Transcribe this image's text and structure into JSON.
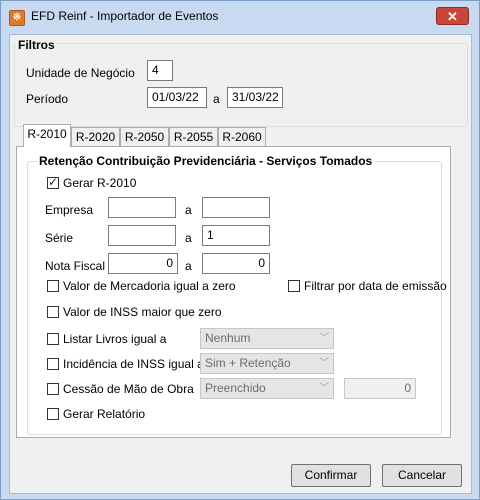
{
  "window": {
    "title": "EFD Reinf - Importador de Eventos",
    "close_glyph": "✕"
  },
  "filtros": {
    "title": "Filtros",
    "unidade_label": "Unidade de Negócio",
    "unidade_value": "4",
    "periodo_label": "Período",
    "periodo_from": "01/03/22",
    "periodo_sep": "a",
    "periodo_to": "31/03/22"
  },
  "tabs": [
    "R-2010",
    "R-2020",
    "R-2050",
    "R-2055",
    "R-2060"
  ],
  "r2010": {
    "group_title": "Retenção Contribuição Previdenciária - Serviços Tomados",
    "gerar_label": "Gerar R-2010",
    "gerar_checked": true,
    "empresa_label": "Empresa",
    "empresa_from": "",
    "empresa_to": "",
    "serie_label": "Série",
    "serie_from": "",
    "serie_to": "1",
    "nota_label": "Nota Fiscal",
    "nota_from": "0",
    "nota_to": "0",
    "sep": "a",
    "valor_mercadoria_label": "Valor de Mercadoria igual a zero",
    "filtrar_data_label": "Filtrar por data de emissão",
    "valor_inss_label": "Valor de INSS maior que zero",
    "listar_livros_label": "Listar Livros igual a",
    "listar_livros_value": "Nenhum",
    "incidencia_label": "Incidência de INSS igual a",
    "incidencia_value": "Sim + Retenção",
    "cessao_label": "Cessão de Mão de Obra",
    "cessao_value": "Preenchido",
    "cessao_amount": "0",
    "gerar_relatorio_label": "Gerar Relatório"
  },
  "buttons": {
    "confirmar": "Confirmar",
    "cancelar": "Cancelar"
  }
}
